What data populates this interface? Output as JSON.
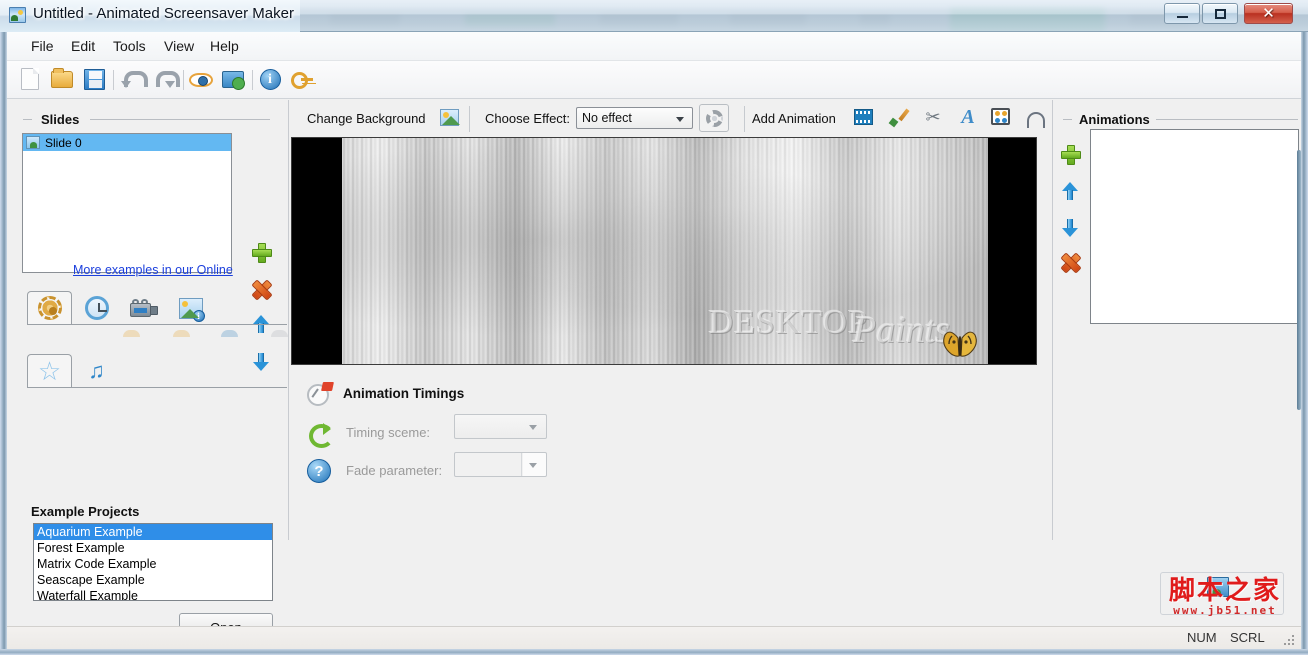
{
  "window": {
    "title": "Untitled - Animated Screensaver Maker",
    "icon": "app-image-icon",
    "buttons": {
      "minimize": "–",
      "maximize": "□",
      "close": "✕"
    }
  },
  "menubar": {
    "items": [
      {
        "label": "File"
      },
      {
        "label": "Edit"
      },
      {
        "label": "Tools"
      },
      {
        "label": "View"
      },
      {
        "label": "Help"
      }
    ]
  },
  "toolbar": {
    "buttons": [
      {
        "name": "new-icon",
        "tooltip": "New"
      },
      {
        "name": "open-icon",
        "tooltip": "Open"
      },
      {
        "name": "save-icon",
        "tooltip": "Save"
      },
      {
        "name": "undo-icon",
        "tooltip": "Undo"
      },
      {
        "name": "redo-icon",
        "tooltip": "Redo"
      },
      {
        "name": "preview-eye-icon",
        "tooltip": "Preview"
      },
      {
        "name": "install-monitor-icon",
        "tooltip": "Install screensaver"
      },
      {
        "name": "info-icon",
        "tooltip": "About"
      },
      {
        "name": "key-icon",
        "tooltip": "Register"
      }
    ]
  },
  "slides": {
    "group_title": "Slides",
    "items": [
      {
        "label": "Slide 0",
        "selected": true
      }
    ],
    "actions": [
      {
        "name": "add-slide-button",
        "icon": "plus-icon"
      },
      {
        "name": "delete-slide-button",
        "icon": "cross-icon"
      },
      {
        "name": "move-slide-up-button",
        "icon": "arrow-up-icon"
      },
      {
        "name": "move-slide-down-button",
        "icon": "arrow-down-icon"
      }
    ]
  },
  "left_tabs_primary": [
    {
      "name": "tab-general",
      "icon": "ship-wheel-icon",
      "active": true
    },
    {
      "name": "tab-timing",
      "icon": "clock-icon",
      "active": false
    },
    {
      "name": "tab-video",
      "icon": "video-camera-icon",
      "active": false
    },
    {
      "name": "tab-image-info",
      "icon": "image-info-icon",
      "active": false
    }
  ],
  "left_tabs_secondary": [
    {
      "name": "tab-examples",
      "icon": "star-icon",
      "active": true
    },
    {
      "name": "tab-music",
      "icon": "music-note-icon",
      "active": false
    }
  ],
  "examples": {
    "title": "Example Projects",
    "items": [
      {
        "label": "Aquarium Example",
        "selected": true
      },
      {
        "label": "Forest Example",
        "selected": false
      },
      {
        "label": "Matrix Code Example",
        "selected": false
      },
      {
        "label": "Seascape Example",
        "selected": false
      },
      {
        "label": "Waterfall Example",
        "selected": false
      }
    ],
    "open_button": "Open",
    "more_link": "More examples in our Online"
  },
  "editbar": {
    "change_background_label": "Change Background",
    "change_background_icon": "image-swap-icon",
    "choose_effect_label": "Choose Effect:",
    "effect_value": "No effect",
    "effect_settings_icon": "gear-icon",
    "add_animation_label": "Add Animation",
    "animation_icons": [
      {
        "name": "film-animation-icon"
      },
      {
        "name": "paintbrush-icon"
      },
      {
        "name": "scissors-icon"
      },
      {
        "name": "text-a-icon"
      },
      {
        "name": "palette-icon"
      },
      {
        "name": "arc-path-icon"
      }
    ]
  },
  "canvas": {
    "watermark_primary": "DESKTOP",
    "watermark_secondary": "Paints",
    "decoration": "butterfly-icon",
    "background_color": "#000000"
  },
  "timings": {
    "title": "Animation Timings",
    "title_icon": "alarm-clock-icon",
    "rows": [
      {
        "icon": "recycle-icon",
        "label": "Timing sceme:",
        "value": ""
      },
      {
        "icon": "help-icon",
        "label": "Fade parameter:",
        "value": ""
      }
    ]
  },
  "animations": {
    "group_title": "Animations",
    "items": [],
    "actions": [
      {
        "name": "add-animation-button",
        "icon": "plus-icon"
      },
      {
        "name": "move-animation-up-button",
        "icon": "arrow-up-icon"
      },
      {
        "name": "move-animation-down-button",
        "icon": "arrow-down-icon"
      },
      {
        "name": "delete-animation-button",
        "icon": "cross-icon"
      }
    ]
  },
  "watermark": {
    "chinese": "脚本之家",
    "url": "www.jb51.net"
  },
  "statusbar": {
    "num": "NUM",
    "scrl": "SCRL"
  },
  "colors": {
    "selection_blue": "#2f8ee8",
    "slide_row_blue": "#63b8f2",
    "link_blue": "#1b3fdd",
    "accent_green": "#6fb832",
    "accent_orange": "#cf4513",
    "watermark_red": "#e01b1b",
    "window_chrome": "#f0f0f0"
  }
}
